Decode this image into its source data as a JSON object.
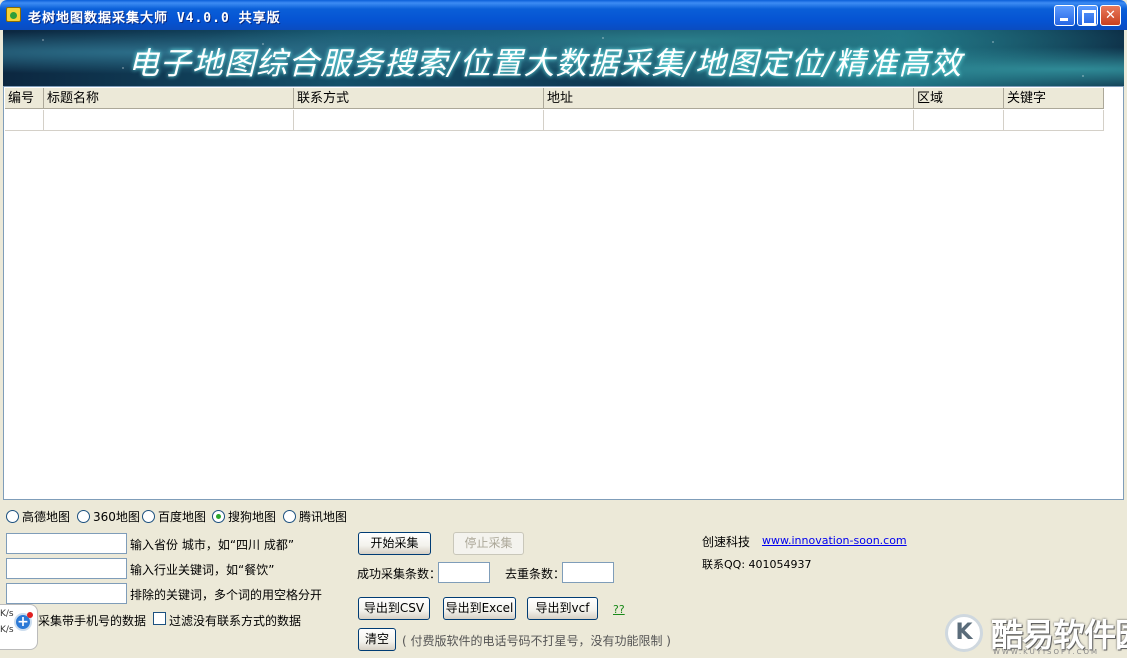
{
  "window": {
    "title": "老树地图数据采集大师 V4.0.0 共享版"
  },
  "banner": {
    "text": "电子地图综合服务搜索/位置大数据采集/地图定位/精准高效"
  },
  "table": {
    "columns": [
      "编号",
      "标题名称",
      "联系方式",
      "地址",
      "区域",
      "关键字"
    ]
  },
  "map_options": [
    {
      "label": "高德地图",
      "selected": false
    },
    {
      "label": "360地图",
      "selected": false
    },
    {
      "label": "百度地图",
      "selected": false
    },
    {
      "label": "搜狗地图",
      "selected": true
    },
    {
      "label": "腾讯地图",
      "selected": false
    }
  ],
  "form": {
    "province_hint": "输入省份 城市，如“四川 成都”",
    "keyword_hint": "输入行业关键词，如“餐饮”",
    "exclude_hint": "排除的关键词，多个词的用空格分开",
    "mobile_only_label": "采集带手机号的数据",
    "filter_no_contact_label": "过滤没有联系方式的数据"
  },
  "actions": {
    "start": "开始采集",
    "stop": "停止采集",
    "success_count_label": "成功采集条数：",
    "dedupe_count_label": "去重条数：",
    "export_csv": "导出到CSV",
    "export_excel": "导出到Excel",
    "export_vcf": "导出到vcf",
    "help": "??",
    "clear": "清空",
    "note": "( 付费版软件的电话号码不打星号，没有功能限制 )"
  },
  "company": {
    "name": "创速科技",
    "website": "www.innovation-soon.com",
    "qq": "联系QQ: 401054937"
  },
  "side_widget": {
    "speed_top": "K/s",
    "speed_bottom": "K/s"
  },
  "watermark": {
    "logo": "K",
    "text": "酷易软件园",
    "sub": "WWW.KUYISOFT.COM"
  }
}
